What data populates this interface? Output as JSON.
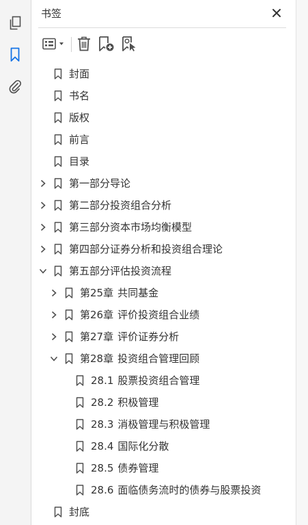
{
  "panel": {
    "title": "书签"
  },
  "icons": {
    "rail": [
      "pages-icon",
      "bookmark-icon",
      "attachment-icon"
    ],
    "toolbar": [
      "options-menu-icon",
      "delete-icon",
      "new-bookmark-icon",
      "new-bookmark-from-structure-icon"
    ]
  },
  "colors": {
    "accent": "#1473e6",
    "icon": "#505050",
    "text": "#333333"
  },
  "bookmarks": [
    {
      "level": 0,
      "expand": "none",
      "num": "",
      "text": "封面"
    },
    {
      "level": 0,
      "expand": "none",
      "num": "",
      "text": "书名"
    },
    {
      "level": 0,
      "expand": "none",
      "num": "",
      "text": "版权"
    },
    {
      "level": 0,
      "expand": "none",
      "num": "",
      "text": "前言"
    },
    {
      "level": 0,
      "expand": "none",
      "num": "",
      "text": "目录"
    },
    {
      "level": 0,
      "expand": "collapsed",
      "num": "",
      "text": "第一部分导论"
    },
    {
      "level": 0,
      "expand": "collapsed",
      "num": "",
      "text": "第二部分投资组合分析"
    },
    {
      "level": 0,
      "expand": "collapsed",
      "num": "",
      "text": "第三部分资本市场均衡模型"
    },
    {
      "level": 0,
      "expand": "collapsed",
      "num": "",
      "text": "第四部分证券分析和投资组合理论"
    },
    {
      "level": 0,
      "expand": "expanded",
      "num": "",
      "text": "第五部分评估投资流程"
    },
    {
      "level": 1,
      "expand": "collapsed",
      "num": "第25章",
      "text": "共同基金"
    },
    {
      "level": 1,
      "expand": "collapsed",
      "num": "第26章",
      "text": "评价投资组合业绩"
    },
    {
      "level": 1,
      "expand": "collapsed",
      "num": "第27章",
      "text": "评价证券分析"
    },
    {
      "level": 1,
      "expand": "expanded",
      "num": "第28章",
      "text": "投资组合管理回顾"
    },
    {
      "level": 2,
      "expand": "none",
      "num": "28.1",
      "text": "股票投资组合管理"
    },
    {
      "level": 2,
      "expand": "none",
      "num": "28.2",
      "text": "积极管理"
    },
    {
      "level": 2,
      "expand": "none",
      "num": "28.3",
      "text": "消极管理与积极管理"
    },
    {
      "level": 2,
      "expand": "none",
      "num": "28.4",
      "text": "国际化分散"
    },
    {
      "level": 2,
      "expand": "none",
      "num": "28.5",
      "text": "债券管理"
    },
    {
      "level": 2,
      "expand": "none",
      "num": "28.6",
      "text": "面临债务流时的债券与股票投资"
    },
    {
      "level": 0,
      "expand": "none",
      "num": "",
      "text": "封底"
    }
  ]
}
